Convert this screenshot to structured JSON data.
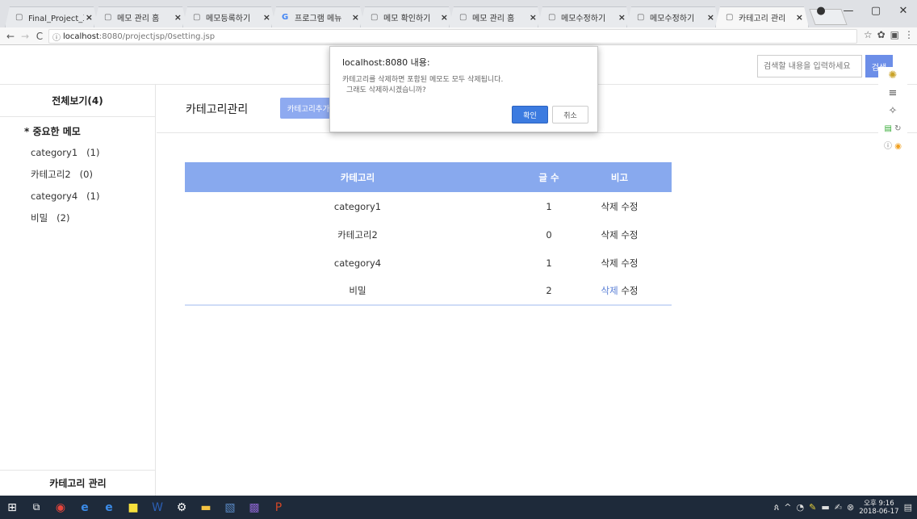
{
  "browser": {
    "tabs": [
      {
        "title": "Final_Project_三",
        "icon": "page-icon",
        "active": false
      },
      {
        "title": "메모 관리 홈",
        "icon": "page-icon",
        "active": false
      },
      {
        "title": "메모등록하기",
        "icon": "page-icon",
        "active": false
      },
      {
        "title": "프로그램 메뉴",
        "icon": "google-icon",
        "active": false
      },
      {
        "title": "메모 확인하기",
        "icon": "page-icon",
        "active": false
      },
      {
        "title": "메모 관리 홈",
        "icon": "page-icon",
        "active": false
      },
      {
        "title": "메모수정하기",
        "icon": "page-icon",
        "active": false
      },
      {
        "title": "메모수정하기",
        "icon": "page-icon",
        "active": false
      },
      {
        "title": "카테고리 관리",
        "icon": "page-icon",
        "active": true
      }
    ],
    "url_host": "localhost",
    "url_rest": ":8080/projectjsp/0setting.jsp"
  },
  "search": {
    "placeholder": "검색할 내용을 입력하세요",
    "button": "검색"
  },
  "sidebar": {
    "title": "전체보기(4)",
    "important": "* 중요한 메모",
    "items": [
      {
        "name": "category1",
        "count": "(1)"
      },
      {
        "name": "카테고리2",
        "count": "(0)"
      },
      {
        "name": "category4",
        "count": "(1)"
      },
      {
        "name": "비밀",
        "count": "(2)"
      }
    ],
    "bottom": "카테고리 관리"
  },
  "content": {
    "title": "카테고리관리",
    "add_button": "카테고리추가",
    "table": {
      "headers": [
        "카테고리",
        "글 수",
        "비고"
      ],
      "rows": [
        {
          "category": "category1",
          "count": "1",
          "delete": "삭제",
          "edit": "수정"
        },
        {
          "category": "카테고리2",
          "count": "0",
          "delete": "삭제",
          "edit": "수정"
        },
        {
          "category": "category4",
          "count": "1",
          "delete": "삭제",
          "edit": "수정"
        },
        {
          "category": "비밀",
          "count": "2",
          "delete": "삭제",
          "edit": "수정"
        }
      ]
    }
  },
  "dialog": {
    "title": "localhost:8080 내용:",
    "message_line1": "카테고리를 삭제하면 포함된 메모도 모두 삭제됩니다.",
    "message_line2": "그래도 삭제하시겠습니까?",
    "ok": "확인",
    "cancel": "취소"
  },
  "taskbar": {
    "time": "오후 9:16",
    "date": "2018-06-17"
  },
  "colors": {
    "accent": "#88a9ee",
    "button": "#6c8ee8",
    "dialog_ok": "#3c7be0",
    "taskbar": "#1e2a3a"
  }
}
